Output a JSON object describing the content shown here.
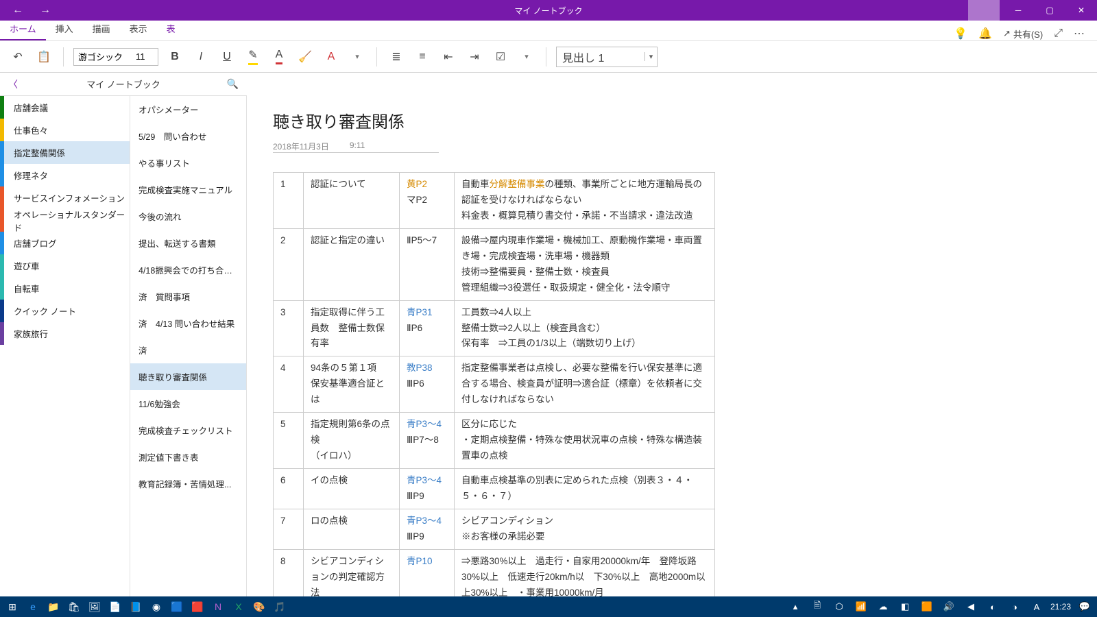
{
  "titlebar": {
    "title": "マイ ノートブック"
  },
  "ribbon": {
    "tabs": [
      "ホーム",
      "挿入",
      "描画",
      "表示",
      "表"
    ],
    "active_index": 0,
    "share_label": "共有(S)"
  },
  "toolbar": {
    "font_name": "游ゴシック",
    "font_size": "11",
    "style_selector": "見出し 1"
  },
  "nav_header": {
    "title": "マイ ノートブック"
  },
  "sections": [
    {
      "label": "店舗会議",
      "color": "#0f7f12"
    },
    {
      "label": "仕事色々",
      "color": "#f2b900"
    },
    {
      "label": "指定整備関係",
      "color": "#1f8fe5",
      "selected": true
    },
    {
      "label": "修理ネタ",
      "color": "#1f8fe5"
    },
    {
      "label": "サービスインフォメーション",
      "color": "#e8562a"
    },
    {
      "label": "オペレーショナルスタンダード",
      "color": "#e8562a"
    },
    {
      "label": "店舗ブログ",
      "color": "#1f8fe5"
    },
    {
      "label": "遊び車",
      "color": "#2bb9b0"
    },
    {
      "label": "自転車",
      "color": "#2bb9b0"
    },
    {
      "label": "クイック ノート",
      "color": "#0b3a8a"
    },
    {
      "label": "家族旅行",
      "color": "#6b3fa0"
    }
  ],
  "pages": [
    {
      "label": "オパシメーター"
    },
    {
      "label": "5/29　問い合わせ"
    },
    {
      "label": "やる事リスト"
    },
    {
      "label": "完成検査実施マニュアル"
    },
    {
      "label": "今後の流れ"
    },
    {
      "label": "提出、転送する書類"
    },
    {
      "label": "4/18振興会での打ち合わ..."
    },
    {
      "label": "済　質問事項"
    },
    {
      "label": "済　4/13 問い合わせ結果"
    },
    {
      "label": "済"
    },
    {
      "label": "聴き取り審査関係",
      "selected": true
    },
    {
      "label": "11/6勉強会"
    },
    {
      "label": "完成検査チェックリスト"
    },
    {
      "label": "測定値下書き表"
    },
    {
      "label": "教育記録簿・苦情処理..."
    }
  ],
  "note": {
    "title": "聴き取り審査関係",
    "date": "2018年11月3日",
    "time": "9:11",
    "rows": [
      {
        "n": "1",
        "title": "認証について",
        "ref": "黄P2\nマP2",
        "ref_class": "ref-yellow",
        "body_pre": "自動車",
        "body_hl": "分解整備事業",
        "body_post": "の種類、事業所ごとに地方運輸局長の認証を受けなければならない\n料金表・概算見積り書交付・承諾・不当請求・違法改造"
      },
      {
        "n": "2",
        "title": "認証と指定の違い",
        "ref": "ⅡP5～7",
        "body": "設備⇒屋内現車作業場・機械加工、原動機作業場・車両置き場・完成検査場・洗車場・機器類\n技術⇒整備要員・整備士数・検査員\n管理組織⇒3役選任・取扱規定・健全化・法令順守"
      },
      {
        "n": "3",
        "title": "指定取得に伴う工員数　整備士数保有率",
        "ref": "青P31\nⅡP6",
        "ref_class": "ref-link",
        "body": "工員数⇒4人以上\n整備士数⇒2人以上（検査員含む）\n保有率　⇒工員の1/3以上（端数切り上げ）"
      },
      {
        "n": "4",
        "title": "94条の５第１項　保安基準適合証とは",
        "ref": "教P38\nⅢP6",
        "ref_class": "ref-link",
        "body": "指定整備事業者は点検し、必要な整備を行い保安基準に適合する場合、検査員が証明⇒適合証（標章）を依頼者に交付しなければならない"
      },
      {
        "n": "5",
        "title": "指定規則第6条の点検\n（イロハ）",
        "ref": "青P3～4\nⅢP7～8",
        "ref_class": "ref-link",
        "body": "区分に応じた\n・定期点検整備・特殊な使用状況車の点検・特殊な構造装置車の点検"
      },
      {
        "n": "6",
        "title": "イの点検",
        "ref": "青P3～4\nⅢP9",
        "ref_class": "ref-link",
        "body": "自動車点検基準の別表に定められた点検（別表３・４・５・６・７）"
      },
      {
        "n": "7",
        "title": "ロの点検",
        "ref": "青P3～4\nⅢP9",
        "ref_class": "ref-link",
        "body": "シビアコンディション\n※お客様の承諾必要"
      },
      {
        "n": "8",
        "title": "シビアコンディションの判定確認方法",
        "ref": "青P10",
        "ref_class": "ref-link",
        "body": "⇒悪路30%以上　過走行・自家用20000km/年　登降坂路30%以上　低速走行20km/h以　下30%以上　高地2000m以上30%以上　・事業用10000km/月"
      }
    ]
  },
  "taskbar": {
    "clock": "21:23"
  }
}
